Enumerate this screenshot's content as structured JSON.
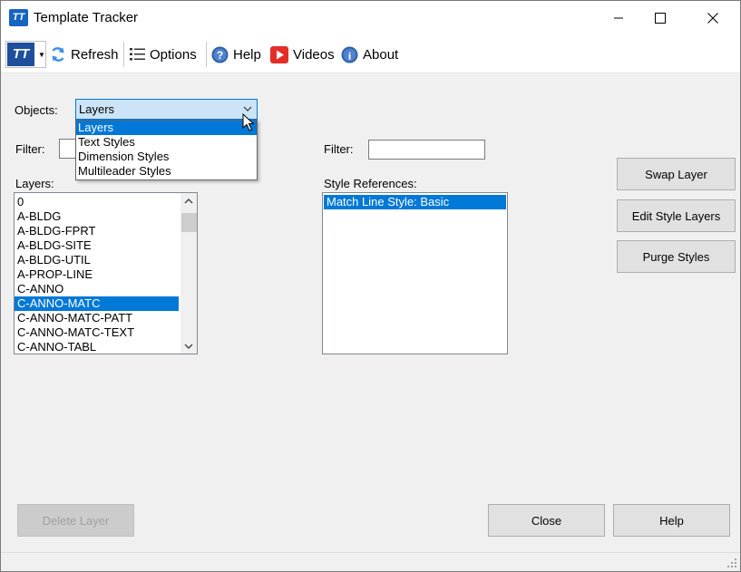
{
  "window": {
    "title": "Template Tracker",
    "app_icon": "TT"
  },
  "toolbar": {
    "logo": "TT",
    "refresh_label": "Refresh",
    "options_label": "Options",
    "help_label": "Help",
    "videos_label": "Videos",
    "about_label": "About"
  },
  "objects": {
    "label": "Objects:",
    "selected": "Layers",
    "options": [
      "Layers",
      "Text Styles",
      "Dimension Styles",
      "Multileader Styles"
    ]
  },
  "left_filter": {
    "label": "Filter:",
    "value": ""
  },
  "right_filter": {
    "label": "Filter:",
    "value": ""
  },
  "layers": {
    "label": "Layers:",
    "items": [
      "0",
      "A-BLDG",
      "A-BLDG-FPRT",
      "A-BLDG-SITE",
      "A-BLDG-UTIL",
      "A-PROP-LINE",
      "C-ANNO",
      "C-ANNO-MATC",
      "C-ANNO-MATC-PATT",
      "C-ANNO-MATC-TEXT",
      "C-ANNO-TABL"
    ],
    "selected": "C-ANNO-MATC"
  },
  "style_refs": {
    "label": "Style References:",
    "items": [
      "Match Line Style: Basic"
    ],
    "selected": "Match Line Style: Basic"
  },
  "buttons": {
    "swap_layer": "Swap Layer",
    "edit_style_layers": "Edit Style Layers",
    "purge_styles": "Purge Styles",
    "delete_layer": "Delete Layer",
    "close": "Close",
    "help": "Help"
  },
  "colors": {
    "accent": "#0078d7",
    "selection": "#0078d7",
    "combo_focus_bg": "#cce4f7"
  }
}
